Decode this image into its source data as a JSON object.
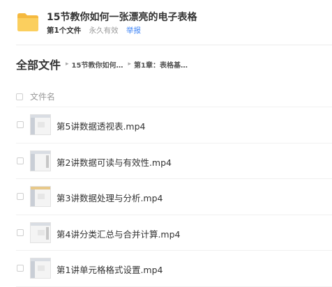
{
  "header": {
    "title": "15节教你如何一张漂亮的电子表格",
    "file_count": "第1个文件",
    "validity": "永久有效",
    "report_link": "举报",
    "folder_icon": "folder-icon",
    "accent_color": "#3b82f6",
    "folder_color": "#f7c14d"
  },
  "breadcrumb": {
    "root": "全部文件",
    "items": [
      "15节教你如何…",
      "第1章：表格基…"
    ]
  },
  "list": {
    "column_name": "文件名",
    "files": [
      {
        "name": "第5讲数据透视表.mp4"
      },
      {
        "name": "第2讲数据可读与有效性.mp4"
      },
      {
        "name": "第3讲数据处理与分析.mp4"
      },
      {
        "name": "第4讲分类汇总与合并计算.mp4"
      },
      {
        "name": "第1讲单元格格式设置.mp4"
      }
    ]
  }
}
